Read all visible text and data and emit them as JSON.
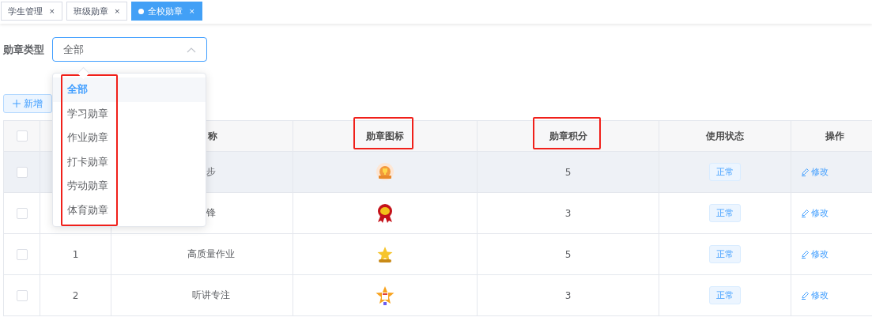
{
  "tabs": [
    {
      "label": "学生管理",
      "close": "×",
      "selected": false
    },
    {
      "label": "班级勋章",
      "close": "×",
      "selected": false
    },
    {
      "label": "全校勋章",
      "close": "×",
      "selected": true
    }
  ],
  "filter": {
    "label": "勋章类型",
    "value": "全部",
    "expanded": true
  },
  "dropdown": {
    "highlighted": true,
    "options": [
      {
        "label": "全部",
        "selected": true
      },
      {
        "label": "学习勋章",
        "selected": false
      },
      {
        "label": "作业勋章",
        "selected": false
      },
      {
        "label": "打卡勋章",
        "selected": false
      },
      {
        "label": "劳动勋章",
        "selected": false
      },
      {
        "label": "体育勋章",
        "selected": false
      }
    ]
  },
  "toolbar": {
    "add_button": "新增"
  },
  "table": {
    "header_checkbox": {
      "checked": false
    },
    "columns": [
      {
        "label": "称",
        "highlighted": false
      },
      {
        "label": "勋章图标",
        "highlighted": true
      },
      {
        "label": "勋章积分",
        "highlighted": true
      },
      {
        "label": "使用状态",
        "highlighted": false
      },
      {
        "label": "操作",
        "highlighted": false
      }
    ],
    "rows": [
      {
        "checked": false,
        "highlighted": true,
        "name": "步",
        "points": "5",
        "status": "正常",
        "action": "修改"
      },
      {
        "checked": false,
        "highlighted": false,
        "name": "锋",
        "points": "3",
        "status": "正常",
        "action": "修改"
      },
      {
        "checked": false,
        "highlighted": false,
        "index": "1",
        "name": "高质量作业",
        "points": "5",
        "status": "正常",
        "action": "修改"
      },
      {
        "checked": false,
        "highlighted": false,
        "index": "2",
        "name": "听讲专注",
        "points": "3",
        "status": "正常",
        "action": "修改"
      }
    ]
  }
}
